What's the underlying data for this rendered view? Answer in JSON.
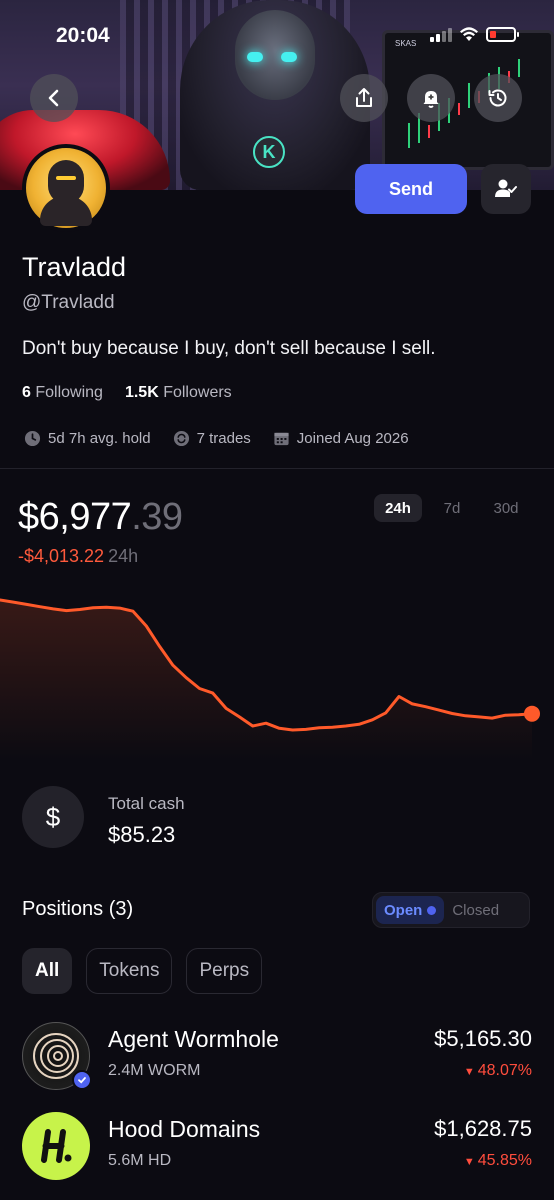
{
  "status": {
    "time": "20:04"
  },
  "banner": {
    "monitor_label": "SKAS"
  },
  "profile": {
    "name": "Travladd",
    "handle": "@Travladd",
    "bio": "Don't buy because I buy, don't sell because I sell.",
    "following_count": "6",
    "following_label": "Following",
    "followers_count": "1.5K",
    "followers_label": "Followers",
    "avg_hold": "5d 7h avg. hold",
    "trades": "7 trades",
    "joined": "Joined Aug 2026"
  },
  "actions": {
    "send_label": "Send"
  },
  "portfolio": {
    "balance_main": "$6,977",
    "balance_decimal": ".39",
    "change": "-$4,013.22",
    "change_period": "24h",
    "ranges": [
      "24h",
      "7d",
      "30d"
    ],
    "active_range": "24h"
  },
  "chart_data": {
    "type": "line",
    "x": [
      0,
      1,
      2,
      3,
      4,
      5,
      6,
      7,
      8,
      9,
      10,
      11,
      12,
      13,
      14,
      15,
      16,
      17,
      18,
      19,
      20,
      21,
      22,
      23,
      24,
      25,
      26,
      27,
      28,
      29,
      30,
      31,
      32,
      33,
      34,
      35,
      36,
      37,
      38,
      39,
      40
    ],
    "values": [
      10977,
      10940,
      10900,
      10860,
      10820,
      10790,
      10810,
      10840,
      10850,
      10835,
      10780,
      10520,
      10160,
      9830,
      9610,
      9420,
      9340,
      9070,
      8920,
      8760,
      8810,
      8720,
      8690,
      8700,
      8730,
      8740,
      8760,
      8790,
      8870,
      8990,
      9280,
      9150,
      9100,
      9040,
      8980,
      8940,
      8920,
      8900,
      8950,
      8960,
      8977
    ],
    "color": "#ff5a2a"
  },
  "cash": {
    "label": "Total cash",
    "value": "$85.23",
    "icon": "dollar-icon"
  },
  "positions": {
    "title": "Positions (3)",
    "toggle_open": "Open",
    "toggle_closed": "Closed",
    "filters": [
      "All",
      "Tokens",
      "Perps"
    ],
    "active_filter": "All",
    "items": [
      {
        "name": "Agent Wormhole",
        "amount": "2.4M WORM",
        "value": "$5,165.30",
        "change": "48.07%",
        "verified": true
      },
      {
        "name": "Hood Domains",
        "amount": "5.6M HD",
        "value": "$1,628.75",
        "change": "45.85%",
        "verified": false
      }
    ]
  },
  "colors": {
    "accent": "#4f63f0",
    "negative": "#ff5a3c",
    "background": "#0c0b12"
  }
}
